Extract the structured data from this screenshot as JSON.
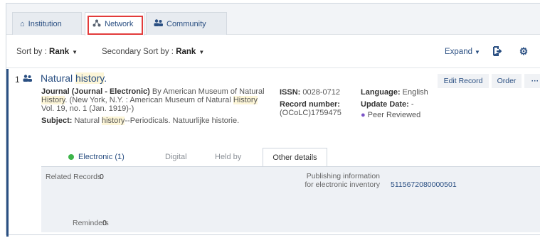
{
  "tabs": [
    {
      "label": "Institution",
      "icon": "house-icon"
    },
    {
      "label": "Network",
      "icon": "network-icon"
    },
    {
      "label": "Community",
      "icon": "people-icon"
    }
  ],
  "sort": {
    "primary_label": "Sort by : ",
    "primary_value": "Rank",
    "secondary_label": "Secondary Sort by : ",
    "secondary_value": "Rank",
    "expand_label": "Expand"
  },
  "record": {
    "number": "1",
    "title_a": "Natural ",
    "title_hl": "history",
    "title_b": ".",
    "desc_1a": "Journal (Journal - Electronic)",
    "desc_1b": " By American Museum of Natural ",
    "desc_hl1": "History",
    "desc_1c": ". (New York, N.Y. : American Museum of Natural ",
    "desc_hl2": "History",
    "desc_1d": " Vol. 19, no. 1 (Jan. 1919)-)",
    "subject_label": "Subject:",
    "subject_a": " Natural ",
    "subject_hl": "history",
    "subject_b": "--Periodicals. Natuurlijke historie.",
    "issn_label": "ISSN:",
    "issn_value": " 0028-0712",
    "record_number_label": "Record number:",
    "record_number_value": "(OCoLC)1759475",
    "language_label": "Language:",
    "language_value": " English",
    "update_label": "Update Date:",
    "update_value": " -",
    "peer_reviewed": "Peer Reviewed",
    "edit_record": "Edit Record",
    "order": "Order",
    "more": "···"
  },
  "subtabs": {
    "electronic": "Electronic (1)",
    "digital": "Digital",
    "held_by": "Held by",
    "other_details": "Other details"
  },
  "other_details": {
    "related_records_label": "Related Records",
    "related_records_value": "0",
    "reminders_label": "Reminders",
    "reminders_value": "0",
    "publishing_label": "Publishing information for electronic inventory",
    "publishing_value": "5115672080000501"
  },
  "colors": {
    "link": "#2a4f82",
    "highlight": "#fdf6d8",
    "electronic_dot": "#3db54a",
    "active_tab_outline": "#e23b3b"
  }
}
